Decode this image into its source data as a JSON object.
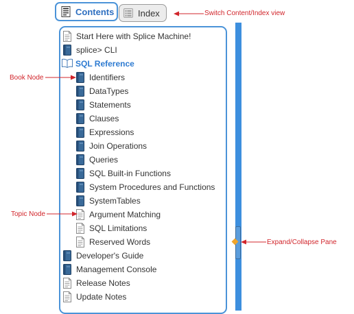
{
  "tabs": {
    "contents_label": "Contents",
    "index_label": "Index"
  },
  "toc": {
    "items": [
      {
        "label": "Start Here with Splice Machine!",
        "icon": "page-icon"
      },
      {
        "label": "splice> CLI",
        "icon": "book-icon"
      },
      {
        "label": "SQL Reference",
        "icon": "open-book-icon",
        "expanded": true
      },
      {
        "label": "Identifiers",
        "icon": "book-icon"
      },
      {
        "label": "DataTypes",
        "icon": "book-icon"
      },
      {
        "label": "Statements",
        "icon": "book-icon"
      },
      {
        "label": "Clauses",
        "icon": "book-icon"
      },
      {
        "label": "Expressions",
        "icon": "book-icon"
      },
      {
        "label": "Join Operations",
        "icon": "book-icon"
      },
      {
        "label": "Queries",
        "icon": "book-icon"
      },
      {
        "label": "SQL Built-in Functions",
        "icon": "book-icon"
      },
      {
        "label": "System Procedures and Functions",
        "icon": "book-icon"
      },
      {
        "label": "SystemTables",
        "icon": "book-icon"
      },
      {
        "label": "Argument Matching",
        "icon": "page-icon"
      },
      {
        "label": "SQL Limitations",
        "icon": "page-icon"
      },
      {
        "label": "Reserved Words",
        "icon": "page-icon"
      },
      {
        "label": "Developer's Guide",
        "icon": "book-icon"
      },
      {
        "label": "Management Console",
        "icon": "book-icon"
      },
      {
        "label": "Release Notes",
        "icon": "page-icon"
      },
      {
        "label": "Update Notes",
        "icon": "page-icon"
      }
    ]
  },
  "annotations": {
    "switch_view": "Switch Content/Index view",
    "book_node": "Book Node",
    "topic_node": "Topic Node",
    "expand_collapse": "Expand/Collapse Pane"
  },
  "colors": {
    "accent": "#4a93d8",
    "scrollbar": "#3d8fde",
    "annotation": "#d1252b",
    "book_icon": "#3a6a99",
    "open_book_label": "#2e7bd1"
  }
}
